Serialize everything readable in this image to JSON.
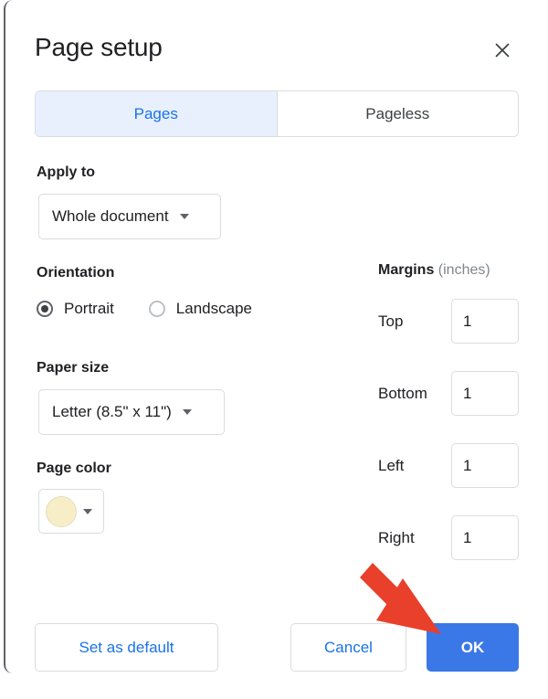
{
  "dialog": {
    "title": "Page setup",
    "close_icon": "close-icon"
  },
  "tabs": [
    {
      "label": "Pages",
      "selected": true
    },
    {
      "label": "Pageless",
      "selected": false
    }
  ],
  "apply_to": {
    "label": "Apply to",
    "value": "Whole document",
    "caret_icon": "chevron-down-icon"
  },
  "orientation": {
    "label": "Orientation",
    "options": [
      {
        "label": "Portrait",
        "selected": true
      },
      {
        "label": "Landscape",
        "selected": false
      }
    ]
  },
  "paper_size": {
    "label": "Paper size",
    "value": "Letter (8.5\" x 11\")",
    "caret_icon": "chevron-down-icon"
  },
  "page_color": {
    "label": "Page color",
    "swatch_hex": "#f7eec7",
    "caret_icon": "chevron-down-icon"
  },
  "margins": {
    "title": "Margins",
    "unit": "(inches)",
    "fields": [
      {
        "name": "Top",
        "value": "1"
      },
      {
        "name": "Bottom",
        "value": "1"
      },
      {
        "name": "Left",
        "value": "1"
      },
      {
        "name": "Right",
        "value": "1"
      }
    ]
  },
  "footer": {
    "set_as_default": "Set as default",
    "cancel": "Cancel",
    "ok": "OK"
  },
  "annotation": {
    "arrow_color": "#e8402a",
    "points_to": "OK"
  },
  "colors": {
    "accent_blue": "#1a73e8",
    "primary_button": "#3b78e7",
    "tab_active_bg": "#e8f0fe",
    "border": "#dadce0",
    "text": "#202124",
    "muted_text": "#80868b"
  }
}
